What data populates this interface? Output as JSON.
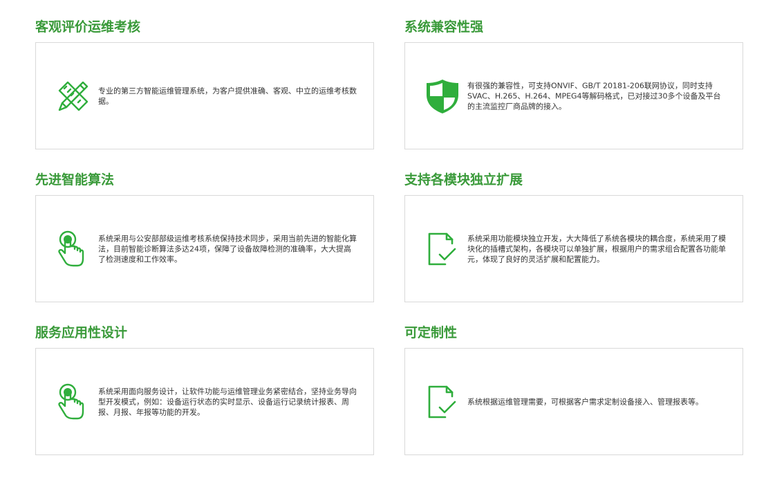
{
  "accent_color": "#3a9a3a",
  "features": [
    {
      "title": "客观评价运维考核",
      "icon": "pencil-ruler-icon",
      "description": "专业的第三方智能运维管理系统，为客户提供准确、客观、中立的运维考核数据。"
    },
    {
      "title": "系统兼容性强",
      "icon": "shield-icon",
      "description": "有很强的兼容性，可支持ONVIF、GB/T 20181-206联网协议，同时支持SVAC、H.265、H.264、MPEG4等解码格式，已对接过30多个设备及平台的主流监控厂商品牌的接入。"
    },
    {
      "title": "先进智能算法",
      "icon": "touch-hand-icon",
      "description": "系统采用与公安部部级运维考核系统保持技术同步，采用当前先进的智能化算法，目前智能诊断算法多达24项，保障了设备故障检测的准确率，大大提高了检测速度和工作效率。"
    },
    {
      "title": "支持各模块独立扩展",
      "icon": "document-check-icon",
      "description": "系统采用功能模块独立开发，大大降低了系统各模块的耦合度，系统采用了模块化的插槽式架构，各模块可以单独扩展，根据用户的需求组合配置各功能单元，体现了良好的灵活扩展和配置能力。"
    },
    {
      "title": "服务应用性设计",
      "icon": "touch-hand-icon",
      "description": "系统采用面向服务设计，让软件功能与运维管理业务紧密结合，坚持业务导向型开发模式，例如：设备运行状态的实时显示、设备运行记录统计报表、周报、月报、年报等功能的开发。"
    },
    {
      "title": "可定制性",
      "icon": "document-check-icon",
      "description": "系统根据运维管理需要，可根据客户需求定制设备接入、管理报表等。"
    }
  ]
}
